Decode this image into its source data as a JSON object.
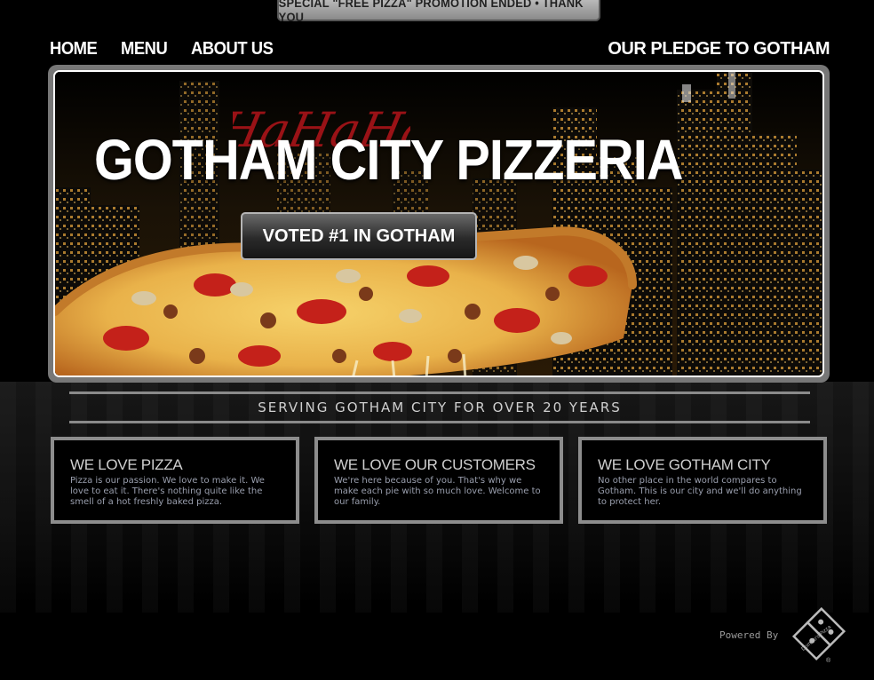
{
  "banner": {
    "text": "SPECIAL \"FREE PIZZA\" PROMOTION ENDED • THANK YOU"
  },
  "nav": {
    "left": [
      {
        "label": "HOME"
      },
      {
        "label": "MENU"
      },
      {
        "label": "ABOUT US"
      }
    ],
    "right": {
      "label": "OUR PLEDGE TO GOTHAM"
    }
  },
  "hero": {
    "title": "GOTHAM CITY PIZZERIA",
    "graffiti": "HaHaHa",
    "button_label": "VOTED #1 IN GOTHAM"
  },
  "tagline": "SERVING GOTHAM CITY FOR OVER 20 YEARS",
  "cards": [
    {
      "title": "WE LOVE PIZZA",
      "body": "Pizza is our passion. We love to make it. We love to eat it. There's nothing quite like the smell of a hot freshly baked pizza."
    },
    {
      "title": "WE LOVE OUR CUSTOMERS",
      "body": "We're here because of you. That's why we make each pie with so much love. Welcome to our family."
    },
    {
      "title": "WE LOVE GOTHAM CITY",
      "body": "No other place in the world compares to Gotham. This is our city and we'll do anything to protect her."
    }
  ],
  "footer": {
    "powered_by": "Powered By",
    "logo_text": "Domino's Pizza",
    "registered_mark": "®"
  },
  "colors": {
    "background": "#000000",
    "frame_gray": "#777777",
    "card_border": "#8d8d8d",
    "card_body_text": "#9a9fae",
    "graffiti_red": "#b3141a"
  }
}
